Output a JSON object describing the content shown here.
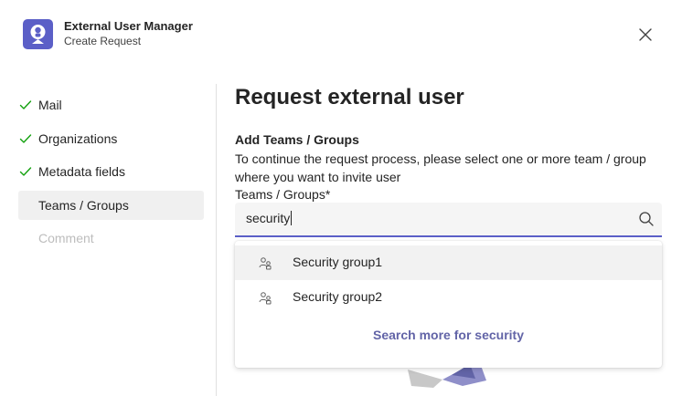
{
  "app": {
    "name": "External User Manager",
    "subtitle": "Create Request"
  },
  "steps": [
    {
      "label": "Mail",
      "state": "completed"
    },
    {
      "label": "Organizations",
      "state": "completed"
    },
    {
      "label": "Metadata fields",
      "state": "completed"
    },
    {
      "label": "Teams / Groups",
      "state": "active"
    },
    {
      "label": "Comment",
      "state": "disabled"
    }
  ],
  "main": {
    "title": "Request external user",
    "section_title": "Add Teams / Groups",
    "section_desc": "To continue the request process, please select one or more team / group where you want to invite user",
    "field_label": "Teams / Groups*",
    "search_value": "security"
  },
  "dropdown": {
    "options": [
      {
        "label": "Security group1",
        "icon": "group-icon",
        "highlighted": true
      },
      {
        "label": "Security group2",
        "icon": "group-icon",
        "highlighted": false
      }
    ],
    "search_more": "Search more for security"
  },
  "colors": {
    "accent": "#5b5fc7",
    "link": "#6264a7",
    "check": "#13a10e"
  }
}
